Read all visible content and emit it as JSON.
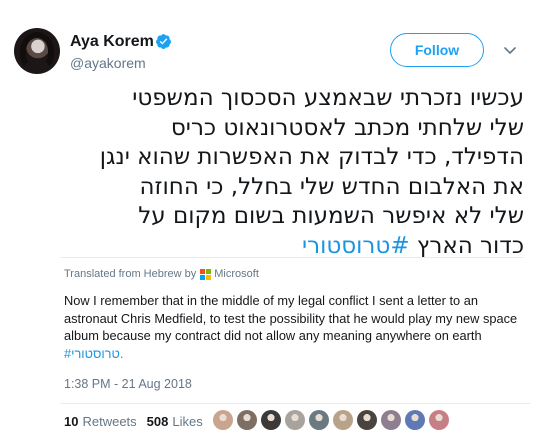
{
  "author": {
    "name": "Aya Korem",
    "handle": "@ayakorem",
    "verified_icon": "verified-badge-icon"
  },
  "actions": {
    "follow_label": "Follow",
    "more_icon": "chevron-down-icon"
  },
  "tweet": {
    "lines": [
      "עכשיו נזכרתי שבאמצע הסכסוך המשפטי",
      "שלי שלחתי מכתב לאסטרונאוט כריס",
      "הדפילד, כדי לבדוק את האפשרות שהוא ינגן",
      "את האלבום החדש שלי בחלל, כי החוזה",
      "שלי לא איפשר השמעות בשום מקום על",
      "כדור הארץ"
    ],
    "hashtag": "#טרוסטורי"
  },
  "translation": {
    "label": "Translated from Hebrew by",
    "provider": "Microsoft",
    "text": "Now I remember that in the middle of my legal conflict I sent a letter to an astronaut Chris Medfield, to test the possibility that he would play my new space album because my contract did not allow any meaning anywhere on earth",
    "hashtag": "#טרוסטורי."
  },
  "timestamp": "1:38 PM - 21 Aug 2018",
  "stats": {
    "retweets_count": "10",
    "retweets_label": "Retweets",
    "likes_count": "508",
    "likes_label": "Likes"
  },
  "colors": {
    "accent": "#1da1f2",
    "link": "#1b95e0",
    "muted": "#657786",
    "text": "#14171a"
  },
  "likers": [
    {
      "color": "#c9a58f"
    },
    {
      "color": "#7d6f64"
    },
    {
      "color": "#3c3a38"
    },
    {
      "color": "#a8a39c"
    },
    {
      "color": "#6a7a80"
    },
    {
      "color": "#b8a38a"
    },
    {
      "color": "#4a4440"
    },
    {
      "color": "#8d7f8f"
    },
    {
      "color": "#5e79b3"
    },
    {
      "color": "#c77f86"
    }
  ]
}
